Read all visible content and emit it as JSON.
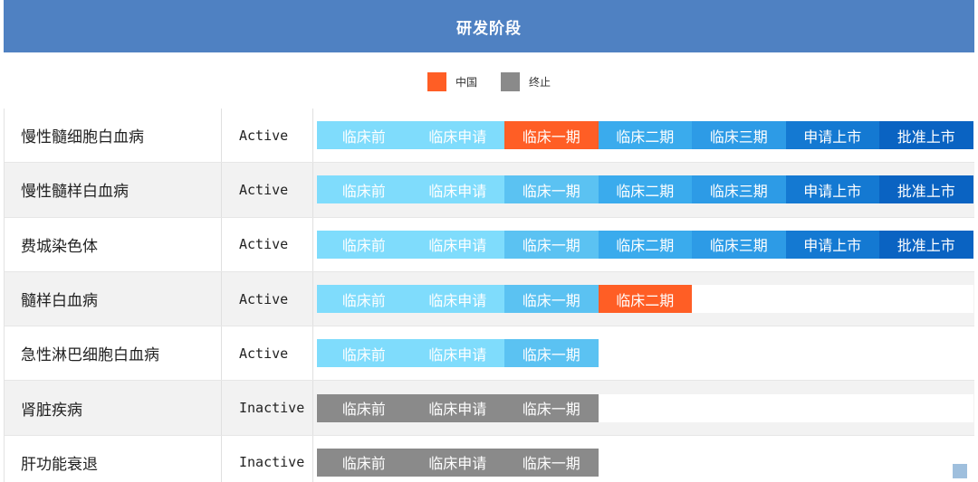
{
  "header": {
    "title": "研发阶段"
  },
  "legend": [
    {
      "label": "中国",
      "color": "#ff5e25"
    },
    {
      "label": "终止",
      "color": "#8a8a8a"
    }
  ],
  "colors": {
    "phase_light": "#7fdcfc",
    "phase_mid": "#5bc2f2",
    "phase_deep": "#2d9be6",
    "phase_deeper": "#1479d2",
    "phase_deepest": "#0a63c2",
    "china": "#ff5e25",
    "terminated": "#8a8a8a"
  },
  "rows": [
    {
      "name": "慢性髓细胞白血病",
      "status": "Active",
      "phases": [
        {
          "label": "临床前",
          "color": "#7fdcfc"
        },
        {
          "label": "临床申请",
          "color": "#7fdcfc"
        },
        {
          "label": "临床一期",
          "color": "#ff5e25"
        },
        {
          "label": "临床二期",
          "color": "#3aabed"
        },
        {
          "label": "临床三期",
          "color": "#2d9be6"
        },
        {
          "label": "申请上市",
          "color": "#1479d2"
        },
        {
          "label": "批准上市",
          "color": "#0a63c2"
        }
      ]
    },
    {
      "name": "慢性髓样白血病",
      "status": "Active",
      "phases": [
        {
          "label": "临床前",
          "color": "#7fdcfc"
        },
        {
          "label": "临床申请",
          "color": "#7fdcfc"
        },
        {
          "label": "临床一期",
          "color": "#5bc2f2"
        },
        {
          "label": "临床二期",
          "color": "#3aabed"
        },
        {
          "label": "临床三期",
          "color": "#2d9be6"
        },
        {
          "label": "申请上市",
          "color": "#1479d2"
        },
        {
          "label": "批准上市",
          "color": "#0a63c2"
        }
      ]
    },
    {
      "name": "费城染色体",
      "status": "Active",
      "phases": [
        {
          "label": "临床前",
          "color": "#7fdcfc"
        },
        {
          "label": "临床申请",
          "color": "#7fdcfc"
        },
        {
          "label": "临床一期",
          "color": "#5bc2f2"
        },
        {
          "label": "临床二期",
          "color": "#3aabed"
        },
        {
          "label": "临床三期",
          "color": "#2d9be6"
        },
        {
          "label": "申请上市",
          "color": "#1479d2"
        },
        {
          "label": "批准上市",
          "color": "#0a63c2"
        }
      ]
    },
    {
      "name": "髓样白血病",
      "status": "Active",
      "phases": [
        {
          "label": "临床前",
          "color": "#7fdcfc"
        },
        {
          "label": "临床申请",
          "color": "#7fdcfc"
        },
        {
          "label": "临床一期",
          "color": "#5bc2f2"
        },
        {
          "label": "临床二期",
          "color": "#ff5e25"
        }
      ]
    },
    {
      "name": "急性淋巴细胞白血病",
      "status": "Active",
      "phases": [
        {
          "label": "临床前",
          "color": "#7fdcfc"
        },
        {
          "label": "临床申请",
          "color": "#7fdcfc"
        },
        {
          "label": "临床一期",
          "color": "#5bc2f2"
        }
      ]
    },
    {
      "name": "肾脏疾病",
      "status": "Inactive",
      "phases": [
        {
          "label": "临床前",
          "color": "#8a8a8a"
        },
        {
          "label": "临床申请",
          "color": "#8a8a8a"
        },
        {
          "label": "临床一期",
          "color": "#8a8a8a"
        }
      ]
    },
    {
      "name": "肝功能衰退",
      "status": "Inactive",
      "phases": [
        {
          "label": "临床前",
          "color": "#8a8a8a"
        },
        {
          "label": "临床申请",
          "color": "#8a8a8a"
        },
        {
          "label": "临床一期",
          "color": "#8a8a8a"
        }
      ]
    }
  ]
}
